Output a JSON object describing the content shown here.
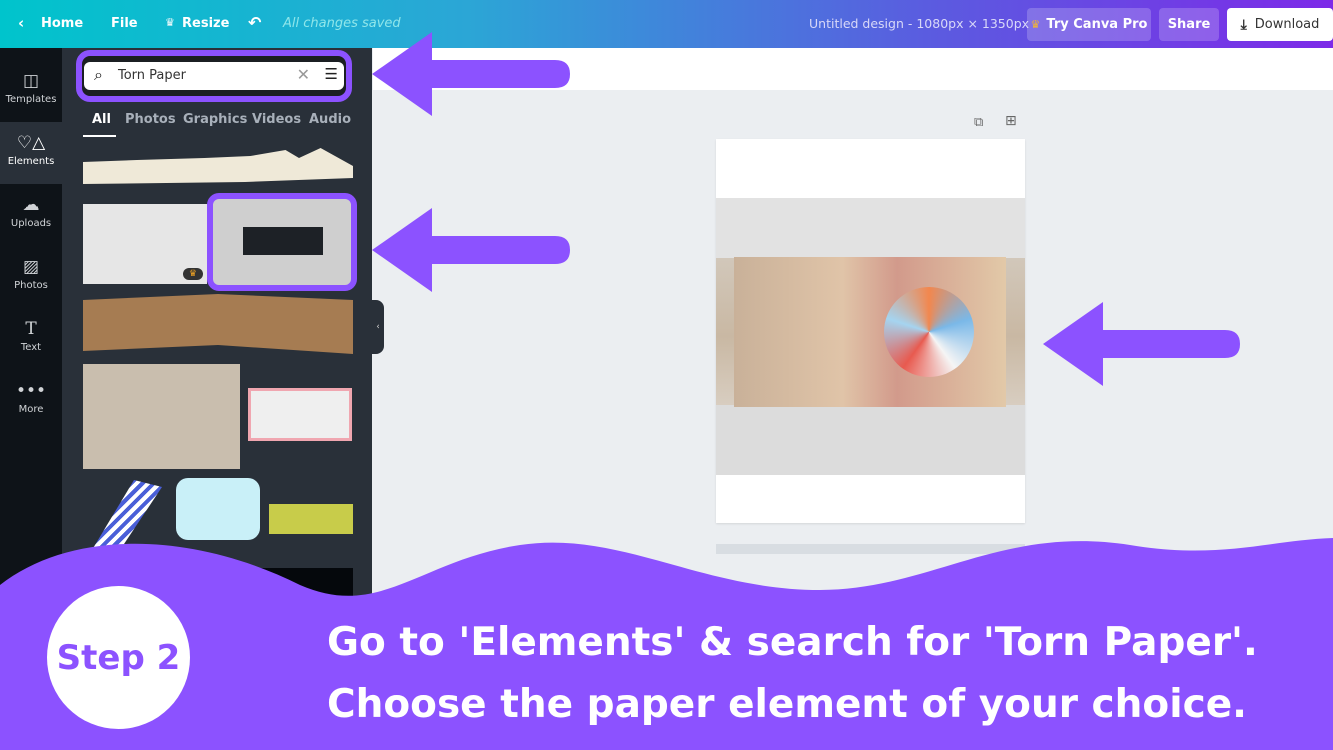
{
  "topbar": {
    "home": "Home",
    "file": "File",
    "resize": "Resize",
    "saved": "All changes saved",
    "title": "Untitled design - 1080px × 1350px",
    "try_pro": "Try Canva Pro",
    "share": "Share",
    "download": "Download"
  },
  "rail": [
    {
      "label": "Templates",
      "icon": "templates-icon"
    },
    {
      "label": "Elements",
      "icon": "elements-icon"
    },
    {
      "label": "Uploads",
      "icon": "upload-icon"
    },
    {
      "label": "Photos",
      "icon": "photos-icon"
    },
    {
      "label": "Text",
      "icon": "text-icon"
    },
    {
      "label": "More",
      "icon": "more-icon"
    }
  ],
  "search": {
    "value": "Torn Paper"
  },
  "tabs": [
    "All",
    "Photos",
    "Graphics",
    "Videos",
    "Audio"
  ],
  "caption": {
    "step": "Step 2",
    "line1": "Go to 'Elements' & search for 'Torn Paper'.",
    "line2": "Choose the paper element of your choice."
  },
  "colors": {
    "accent": "#8c52ff",
    "panel": "#293039",
    "rail": "#0e1318"
  }
}
